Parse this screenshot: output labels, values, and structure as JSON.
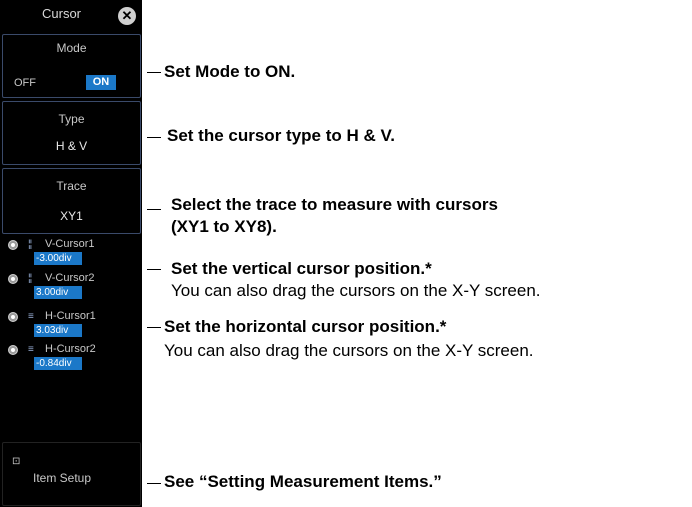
{
  "panel": {
    "title": "Cursor",
    "mode": {
      "label": "Mode",
      "off": "OFF",
      "on": "ON"
    },
    "type": {
      "label": "Type",
      "value": "H & V"
    },
    "trace": {
      "label": "Trace",
      "value": "XY1"
    },
    "cursors": [
      {
        "name": "V-Cursor1",
        "value": "-3.00div",
        "icon": "v-cursor-icon"
      },
      {
        "name": "V-Cursor2",
        "value": "3.00div",
        "icon": "v-cursor-icon"
      },
      {
        "name": "H-Cursor1",
        "value": "3.03div",
        "icon": "h-cursor-icon"
      },
      {
        "name": "H-Cursor2",
        "value": "-0.84div",
        "icon": "h-cursor-icon"
      }
    ],
    "item_setup": "Item Setup"
  },
  "annotations": {
    "mode": "Set Mode to ON.",
    "type": "Set the cursor type to H & V.",
    "trace_line1": "Select the trace to measure with cursors",
    "trace_line2": "(XY1 to XY8).",
    "vertical_bold": "Set the vertical cursor position.*",
    "vertical_note": "You can also drag the cursors on the X-Y screen.",
    "horizontal_bold": "Set the horizontal cursor position.*",
    "horizontal_note": "You can also drag the cursors on the X-Y screen.",
    "item_setup": "See “Setting Measurement Items.”"
  },
  "colors": {
    "panel_bg": "#000000",
    "accent": "#1b78c8",
    "text": "#c8c8c8"
  }
}
